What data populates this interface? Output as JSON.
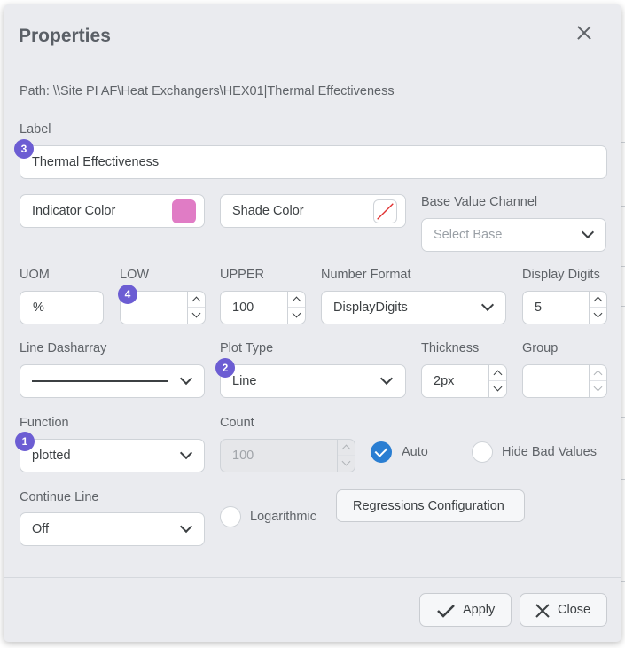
{
  "dialog": {
    "title": "Properties"
  },
  "path": {
    "text": "Path: \\\\Site PI AF\\Heat Exchangers\\HEX01|Thermal Effectiveness"
  },
  "label_field": {
    "label": "Label",
    "value": "Thermal Effectiveness",
    "badge": "3"
  },
  "indicator_color": {
    "label": "Indicator Color",
    "color": "#e07cc5"
  },
  "shade_color": {
    "label": "Shade Color"
  },
  "base_value_channel": {
    "label": "Base Value Channel",
    "placeholder": "Select Base"
  },
  "uom": {
    "label": "UOM",
    "value": "%"
  },
  "low": {
    "label": "LOW",
    "value": "",
    "badge": "4"
  },
  "upper": {
    "label": "UPPER",
    "value": "100"
  },
  "number_format": {
    "label": "Number Format",
    "value": "DisplayDigits"
  },
  "display_digits": {
    "label": "Display Digits",
    "value": "5"
  },
  "line_dasharray": {
    "label": "Line Dasharray"
  },
  "plot_type": {
    "label": "Plot Type",
    "value": "Line",
    "badge": "2"
  },
  "thickness": {
    "label": "Thickness",
    "value": "2px"
  },
  "group": {
    "label": "Group",
    "value": ""
  },
  "function": {
    "label": "Function",
    "value": "plotted",
    "badge": "1"
  },
  "count": {
    "label": "Count",
    "value": "100"
  },
  "auto": {
    "label": "Auto",
    "checked": true
  },
  "hide_bad_values": {
    "label": "Hide Bad Values",
    "checked": false
  },
  "continue_line": {
    "label": "Continue Line",
    "value": "Off"
  },
  "logarithmic": {
    "label": "Logarithmic",
    "checked": false
  },
  "regressions": {
    "label": "Regressions Configuration"
  },
  "buttons": {
    "apply": "Apply",
    "close": "Close"
  },
  "colors": {
    "badge": "#6c5dd3",
    "checkbox_on": "#2a7ed2",
    "dialog_bg": "#eaebef"
  }
}
